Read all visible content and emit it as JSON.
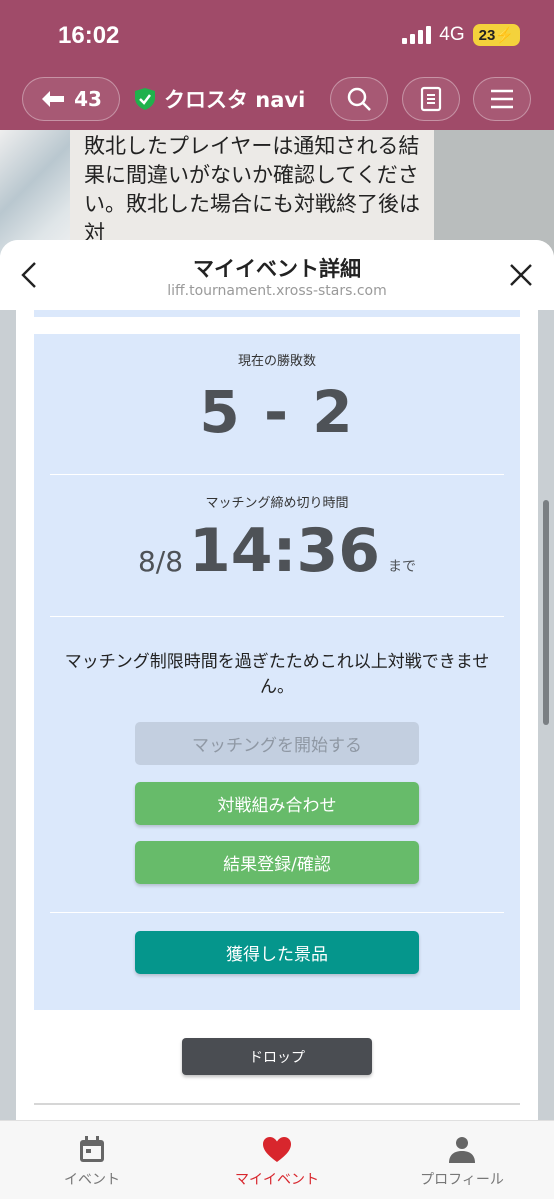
{
  "status_bar": {
    "time": "16:02",
    "network": "4G",
    "battery": "23"
  },
  "line_header": {
    "unread_count": "43",
    "bot_name": "クロスタ navi"
  },
  "chat_preview": {
    "text": "敗北したプレイヤーは通知される結果に間違いがないか確認してください。敗北した場合にも対戦終了後は対"
  },
  "sheet": {
    "title": "マイイベント詳細",
    "url": "liff.tournament.xross-stars.com"
  },
  "record": {
    "label": "現在の勝敗数",
    "score": "5 - 2"
  },
  "deadline": {
    "label": "マッチング締め切り時間",
    "date": "8/8",
    "time": "14:36",
    "suffix": "まで"
  },
  "message": "マッチング制限時間を過ぎたためこれ以上対戦できません。",
  "buttons": {
    "start_matching": "マッチングを開始する",
    "pairings": "対戦組み合わせ",
    "result_entry": "結果登録/確認",
    "prizes": "獲得した景品",
    "drop": "ドロップ"
  },
  "bottom_nav": {
    "items": [
      {
        "label": "イベント",
        "icon": "calendar-icon",
        "active": false
      },
      {
        "label": "マイイベント",
        "icon": "heart-icon",
        "active": true
      },
      {
        "label": "プロフィール",
        "icon": "person-icon",
        "active": false
      }
    ]
  },
  "colors": {
    "header": "#a04b69",
    "panel": "#dbe8fb",
    "green": "#67bb6a",
    "teal": "#05968c",
    "active_nav": "#d8262d"
  }
}
